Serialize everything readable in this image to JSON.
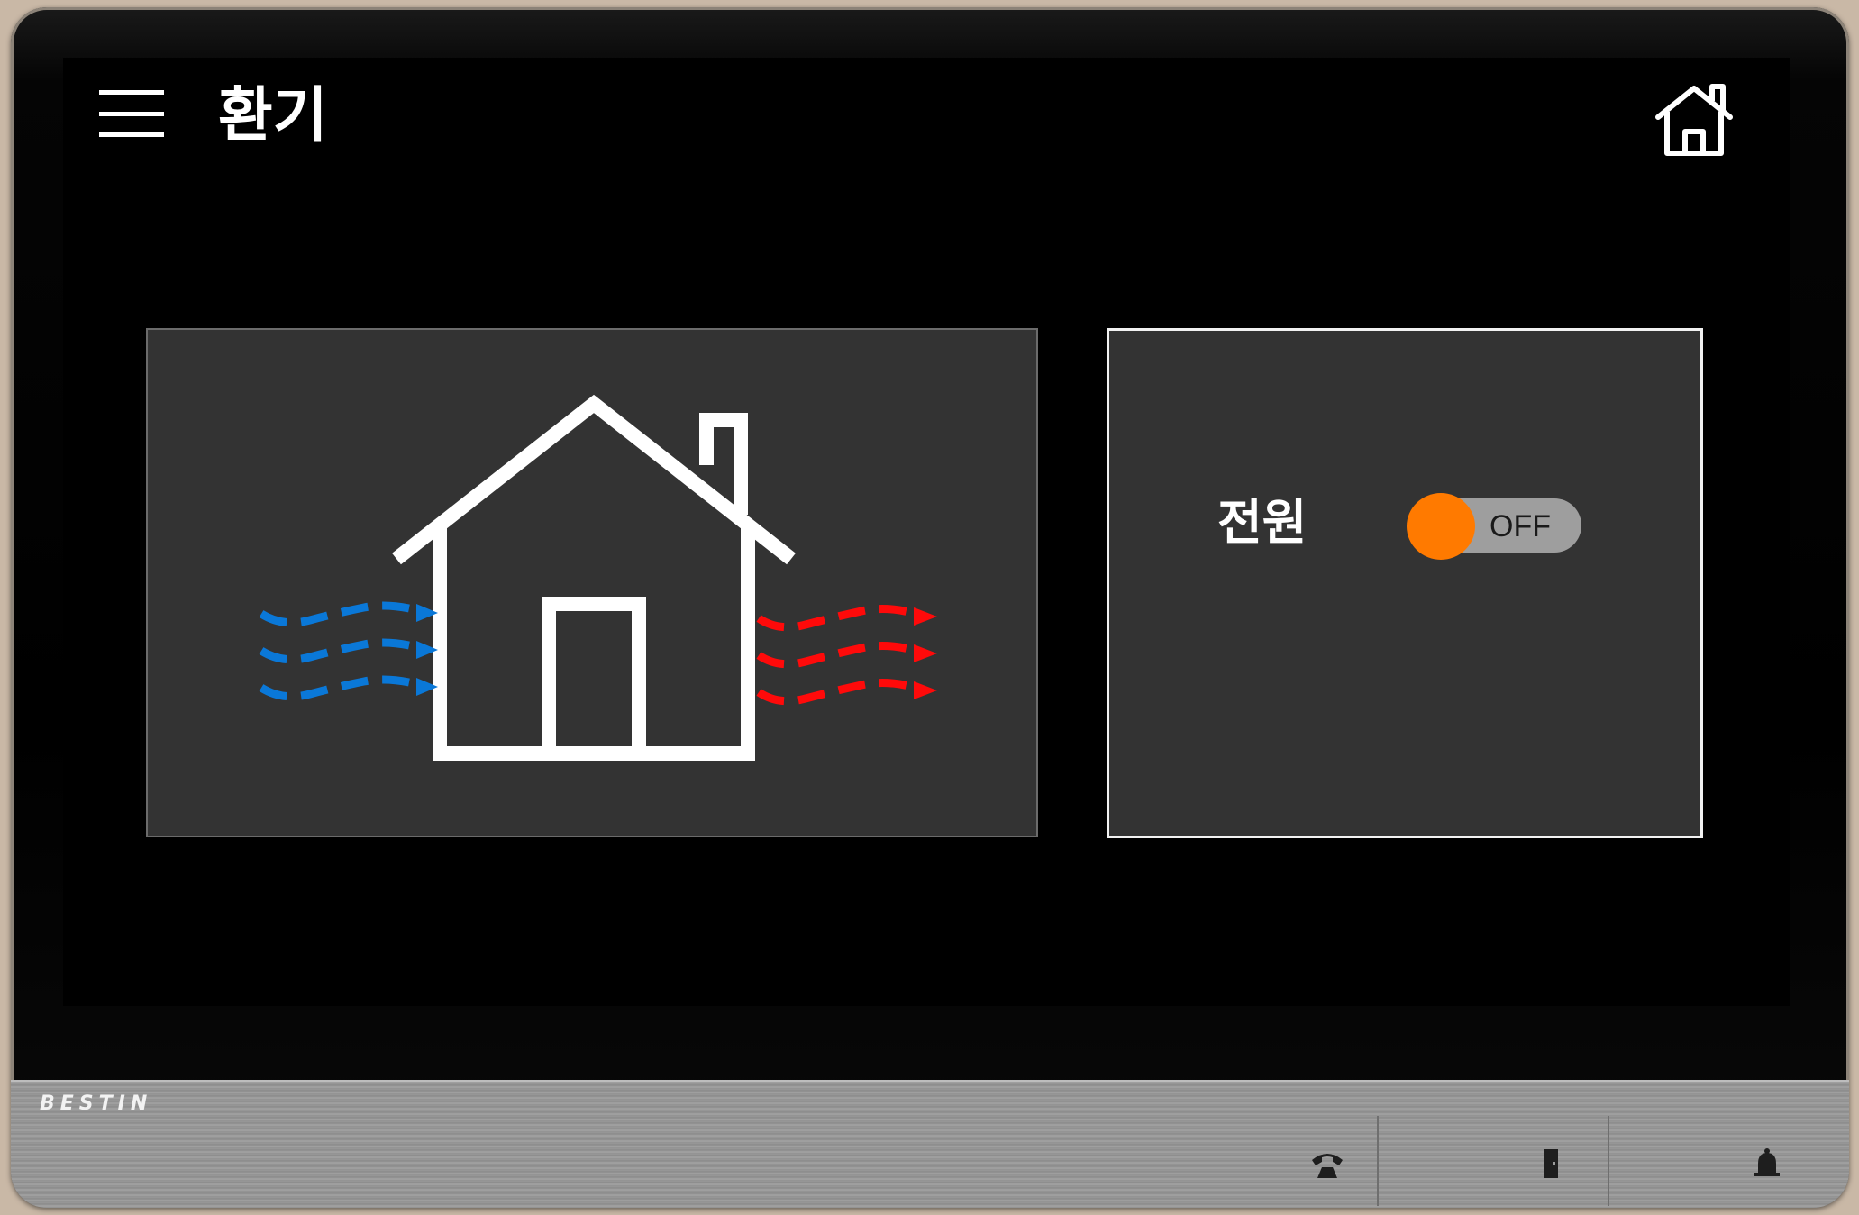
{
  "header": {
    "menu_icon": "hamburger-menu-icon",
    "title": "환기",
    "home_icon": "home-icon"
  },
  "illustration": {
    "house_icon": "house-icon",
    "inflow_icon": "wavy-arrows-icon",
    "outflow_icon": "wavy-arrows-icon",
    "inflow_color": "#0a78d8",
    "outflow_color": "#ff0a0a"
  },
  "control": {
    "power_label": "전원",
    "power_toggle": {
      "state_text": "OFF",
      "is_on": false,
      "knob_color": "#ff7a00",
      "track_color": "#9e9e9e"
    }
  },
  "device": {
    "brand": "BESTIN",
    "hardware_buttons": [
      {
        "icon": "phone-icon"
      },
      {
        "icon": "door-icon"
      },
      {
        "icon": "bell-icon"
      }
    ]
  }
}
